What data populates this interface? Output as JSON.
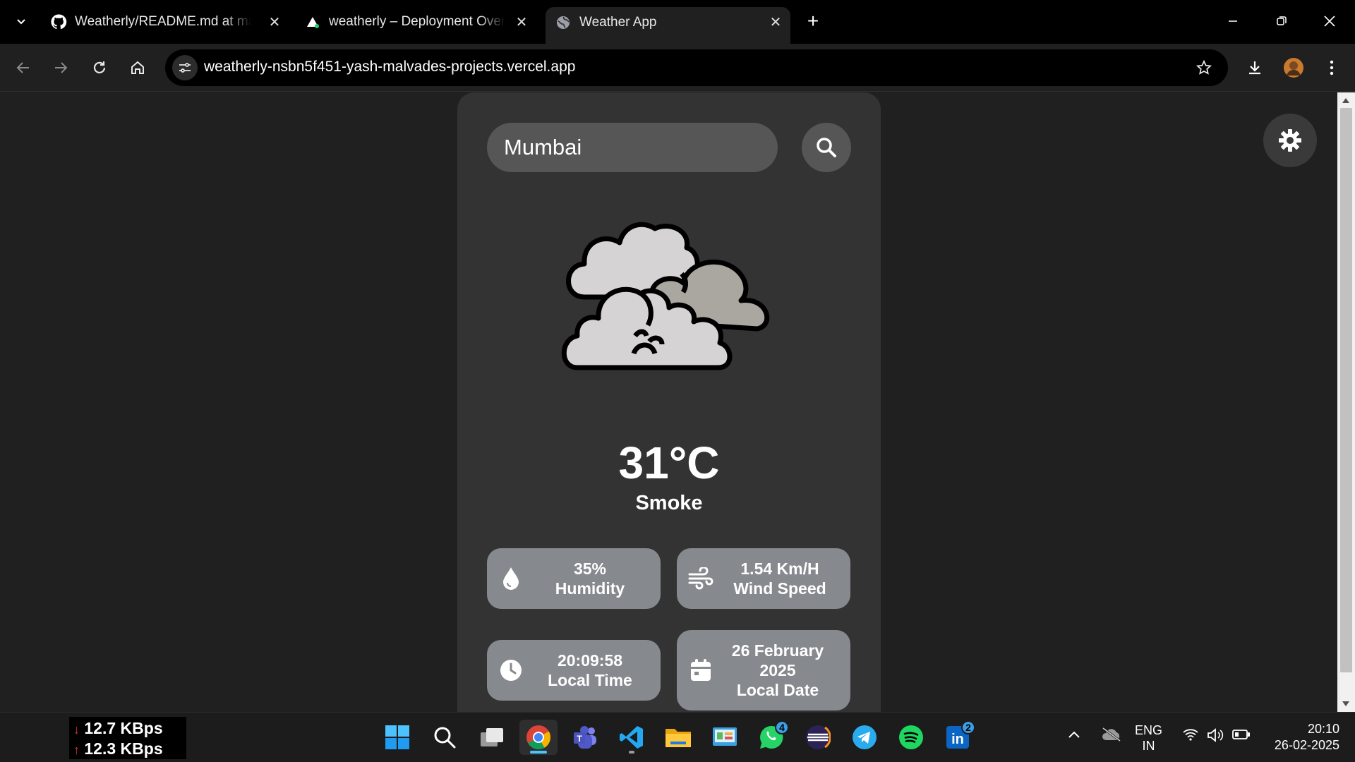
{
  "browser": {
    "tabs": [
      {
        "title": "Weatherly/README.md at main",
        "icon": "github-icon",
        "active": false
      },
      {
        "title": "weatherly – Deployment Overvi",
        "icon": "vercel-icon",
        "active": false
      },
      {
        "title": "Weather App",
        "icon": "globe-icon",
        "active": true
      }
    ],
    "url": "weatherly-nsbn5f451-yash-malvades-projects.vercel.app"
  },
  "app": {
    "search": {
      "value": "Mumbai"
    },
    "temperature": "31°C",
    "condition": "Smoke",
    "stats": {
      "humidity": {
        "value": "35%",
        "label": "Humidity",
        "icon": "droplet-icon"
      },
      "wind": {
        "value": "1.54 Km/H",
        "label": "Wind Speed",
        "icon": "wind-icon"
      },
      "time": {
        "value": "20:09:58",
        "label": "Local Time",
        "icon": "clock-icon"
      },
      "date": {
        "value": "26 February 2025",
        "label": "Local Date",
        "icon": "calendar-icon"
      }
    }
  },
  "taskbar": {
    "net_down": "12.7 KBps",
    "net_up": "12.3 KBps",
    "whatsapp_badge": "4",
    "linkedin_badge": "2",
    "lang": "ENG",
    "region": "IN",
    "time": "20:10",
    "date": "26-02-2025"
  },
  "colors": {
    "page_bg": "#202020",
    "card_bg": "#333333",
    "stat_bg": "#86898d",
    "input_bg": "#565656"
  }
}
